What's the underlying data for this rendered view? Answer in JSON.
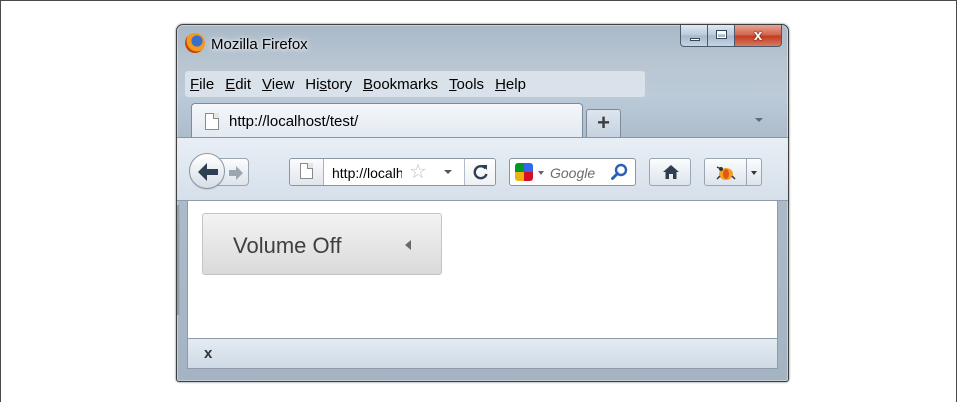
{
  "window": {
    "title": "Mozilla Firefox"
  },
  "menu": [
    {
      "pre": "",
      "u": "F",
      "post": "ile"
    },
    {
      "pre": "",
      "u": "E",
      "post": "dit"
    },
    {
      "pre": "",
      "u": "V",
      "post": "iew"
    },
    {
      "pre": "Hi",
      "u": "s",
      "post": "tory"
    },
    {
      "pre": "",
      "u": "B",
      "post": "ookmarks"
    },
    {
      "pre": "",
      "u": "T",
      "post": "ools"
    },
    {
      "pre": "",
      "u": "H",
      "post": "elp"
    }
  ],
  "tab": {
    "label": "http://localhost/test/",
    "new_tab_symbol": "+"
  },
  "urlbar": {
    "value": "http://localhost/test/",
    "star": "☆"
  },
  "search": {
    "placeholder": "Google",
    "engine_icon": "google-icon"
  },
  "page": {
    "volume_button_label": "Volume Off"
  },
  "addon_bar": {
    "close_label": "x"
  },
  "caption_buttons": {
    "close_label": "x"
  },
  "colors": {
    "chrome_blue": "#bccbd9",
    "close_red": "#c0391f",
    "button_gray": "#dadada"
  }
}
